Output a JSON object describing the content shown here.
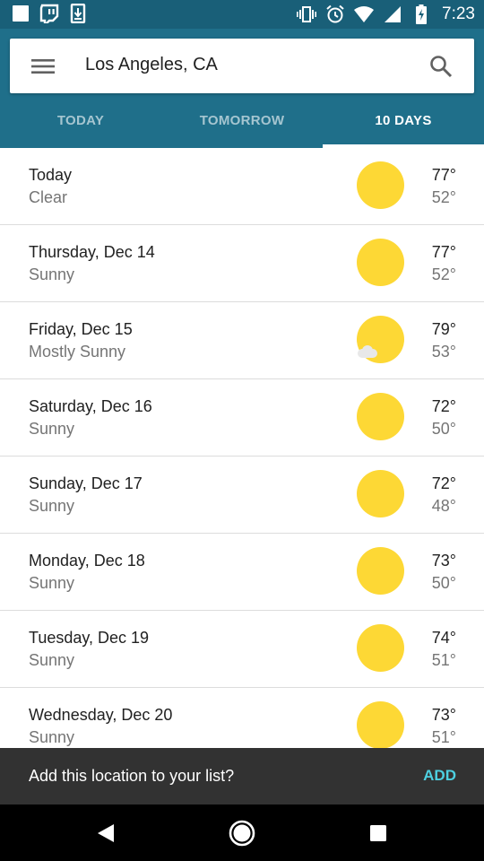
{
  "status_bar": {
    "time": "7:23",
    "left_icons": [
      "blank-notification-icon",
      "twitch-icon",
      "download-icon"
    ],
    "right_icons": [
      "vibrate-icon",
      "alarm-icon",
      "wifi-icon",
      "signal-icon",
      "battery-charging-icon"
    ]
  },
  "search": {
    "location": "Los Angeles, CA",
    "menu_icon": "menu-icon",
    "search_icon": "search-icon"
  },
  "tabs": [
    {
      "label": "TODAY",
      "active": false
    },
    {
      "label": "TOMORROW",
      "active": false
    },
    {
      "label": "10 DAYS",
      "active": true
    }
  ],
  "forecast": [
    {
      "day": "Today",
      "condition": "Clear",
      "icon": "sun-icon",
      "high": "77°",
      "low": "52°"
    },
    {
      "day": "Thursday, Dec 14",
      "condition": "Sunny",
      "icon": "sun-icon",
      "high": "77°",
      "low": "52°"
    },
    {
      "day": "Friday, Dec 15",
      "condition": "Mostly Sunny",
      "icon": "sun-cloud-icon",
      "high": "79°",
      "low": "53°"
    },
    {
      "day": "Saturday, Dec 16",
      "condition": "Sunny",
      "icon": "sun-icon",
      "high": "72°",
      "low": "50°"
    },
    {
      "day": "Sunday, Dec 17",
      "condition": "Sunny",
      "icon": "sun-icon",
      "high": "72°",
      "low": "48°"
    },
    {
      "day": "Monday, Dec 18",
      "condition": "Sunny",
      "icon": "sun-icon",
      "high": "73°",
      "low": "50°"
    },
    {
      "day": "Tuesday, Dec 19",
      "condition": "Sunny",
      "icon": "sun-icon",
      "high": "74°",
      "low": "51°"
    },
    {
      "day": "Wednesday, Dec 20",
      "condition": "Sunny",
      "icon": "sun-icon",
      "high": "73°",
      "low": "51°"
    }
  ],
  "snackbar": {
    "message": "Add this location to your list?",
    "action": "ADD"
  },
  "colors": {
    "appbar": "#1f6f8a",
    "status_bar": "#195f78",
    "sun": "#fdd835",
    "snackbar_action": "#4dd0e1"
  }
}
